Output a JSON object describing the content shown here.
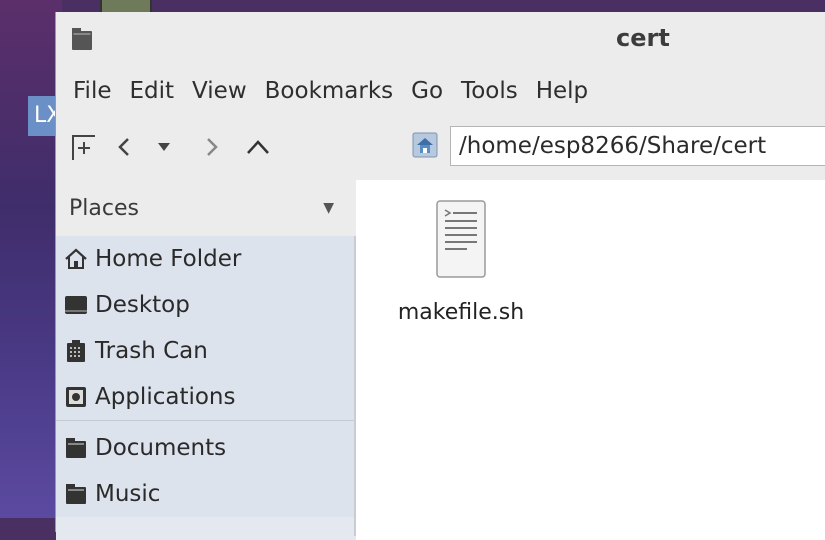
{
  "window": {
    "title": "cert"
  },
  "menubar": {
    "items": [
      "File",
      "Edit",
      "View",
      "Bookmarks",
      "Go",
      "Tools",
      "Help"
    ]
  },
  "toolbar": {
    "path": "/home/esp8266/Share/cert"
  },
  "desktop": {
    "label": "LX"
  },
  "sidebar": {
    "header": "Places",
    "items": [
      {
        "label": "Home Folder",
        "icon": "home-icon"
      },
      {
        "label": "Desktop",
        "icon": "desktop-icon"
      },
      {
        "label": "Trash Can",
        "icon": "trash-icon"
      },
      {
        "label": "Applications",
        "icon": "applications-icon"
      }
    ],
    "bookmarks": [
      {
        "label": "Documents",
        "icon": "folder-icon"
      },
      {
        "label": "Music",
        "icon": "folder-icon"
      }
    ]
  },
  "files": [
    {
      "name": "makefile.sh",
      "icon": "script-file-icon"
    }
  ],
  "colors": {
    "sidebar_bg": "#dde3ec",
    "window_bg": "#ececec",
    "content_bg": "#ffffff"
  }
}
